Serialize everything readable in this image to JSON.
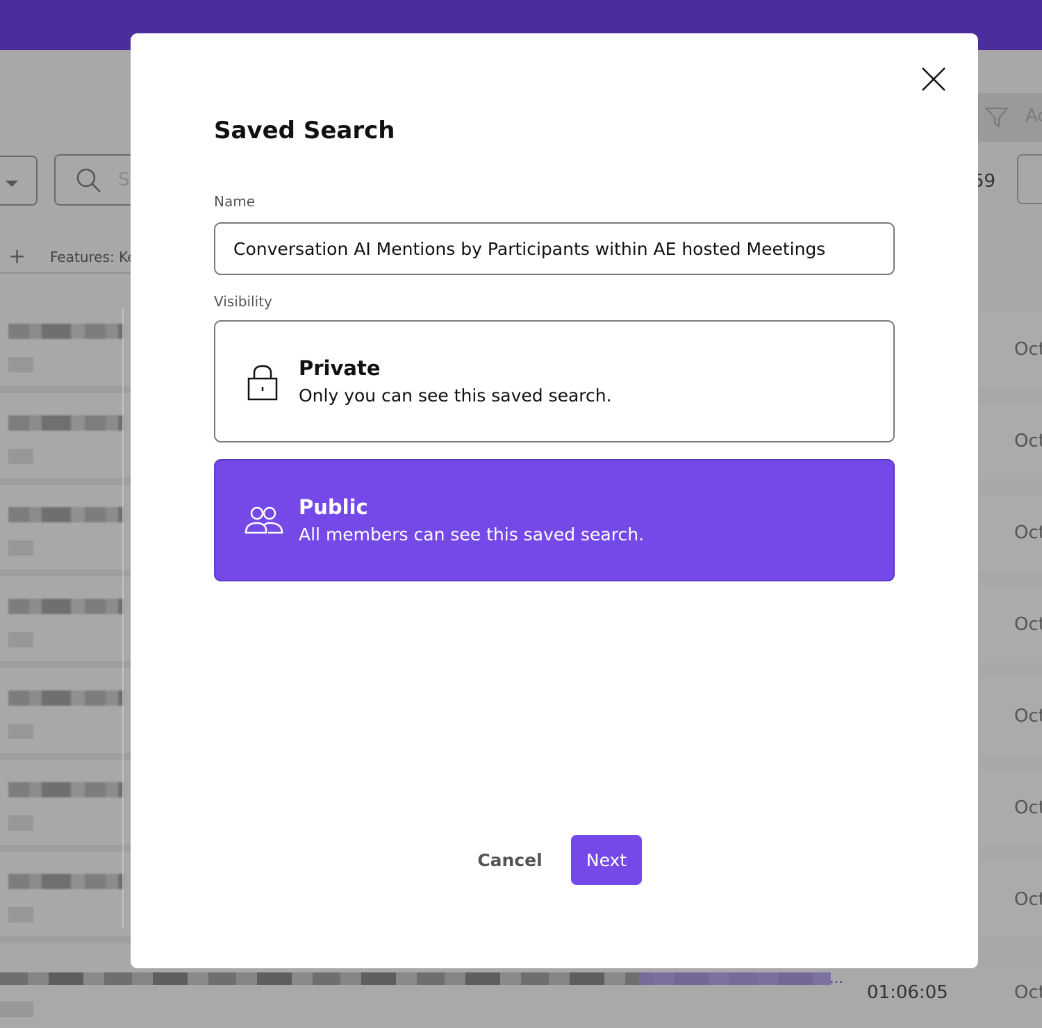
{
  "background": {
    "search_placeholder": "Se",
    "features_label": "Features: Ke",
    "right_header_text": "Ac",
    "right_number": "59",
    "date_label": "Oct",
    "duration": "01:06:05"
  },
  "modal": {
    "title": "Saved Search",
    "name_label": "Name",
    "name_value": "Conversation AI Mentions by Participants within AE hosted Meetings",
    "visibility_label": "Visibility",
    "options": [
      {
        "title": "Private",
        "description": "Only you can see this saved search.",
        "icon": "lock-icon",
        "selected": false
      },
      {
        "title": "Public",
        "description": "All members can see this saved search.",
        "icon": "users-icon",
        "selected": true
      }
    ],
    "cancel_label": "Cancel",
    "next_label": "Next"
  },
  "colors": {
    "topbar": "#4b2d9c",
    "accent": "#7548e8",
    "overlay": "#a8a8a8"
  }
}
